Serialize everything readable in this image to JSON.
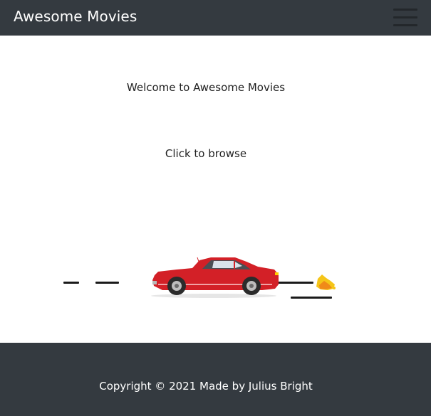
{
  "navbar": {
    "brand": "Awesome Movies",
    "menu_icon": "hamburger-menu-icon"
  },
  "main": {
    "welcome_text": "Welcome to Awesome Movies",
    "browse_text": "Click to browse",
    "illustration": "red-car-icon"
  },
  "footer": {
    "copyright": "Copyright © 2021 Made by Julius Bright"
  },
  "colors": {
    "navbar_bg": "#343a40",
    "footer_bg": "#343a40",
    "car_red": "#d32027",
    "page_bg": "#ffffff"
  }
}
